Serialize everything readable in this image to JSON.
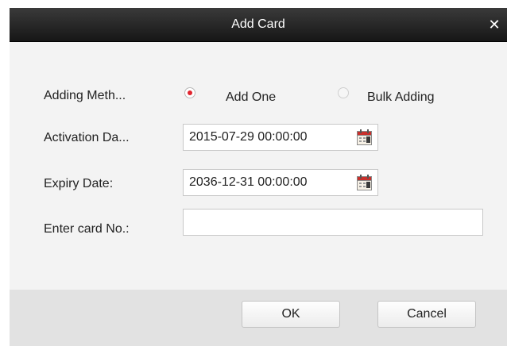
{
  "dialog": {
    "title": "Add Card",
    "close_glyph": "✕"
  },
  "form": {
    "adding_method": {
      "label": "Adding Meth...",
      "options": [
        {
          "label": "Add One",
          "checked": true
        },
        {
          "label": "Bulk Adding",
          "checked": false
        }
      ]
    },
    "activation_date": {
      "label": "Activation Da...",
      "value": "2015-07-29 00:00:00",
      "icon": "calendar-icon"
    },
    "expiry_date": {
      "label": "Expiry Date:",
      "value": "2036-12-31 00:00:00",
      "icon": "calendar-icon"
    },
    "card_no": {
      "label": "Enter card No.:",
      "value": ""
    }
  },
  "footer": {
    "ok_label": "OK",
    "cancel_label": "Cancel"
  },
  "colors": {
    "accent": "#e0242e",
    "titlebar": "#1e1e1e",
    "body_bg": "#f3f3f3",
    "footer_bg": "#e2e2e2"
  }
}
